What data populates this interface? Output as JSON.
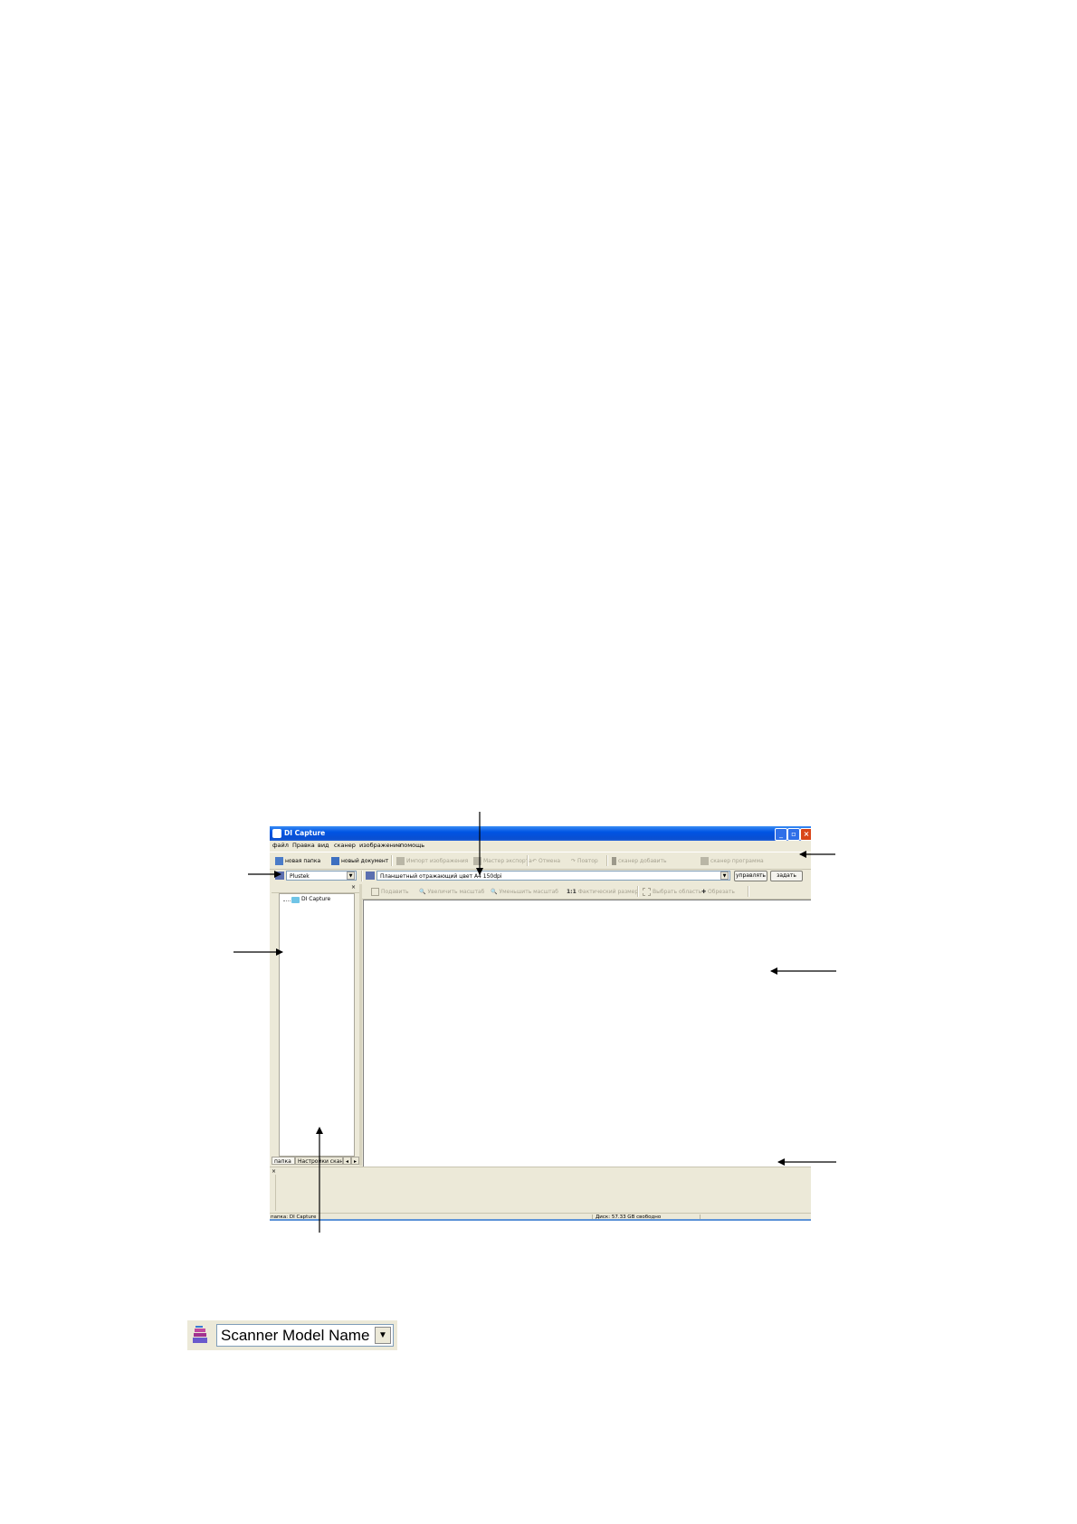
{
  "window": {
    "title": "DI Capture"
  },
  "menu": [
    "файл",
    "Правка",
    "вид",
    "сканер",
    "изображение",
    "помощь"
  ],
  "toolbar": {
    "new_folder": "новая папка",
    "new_document": "новый документ",
    "import_images": "Импорт изображения",
    "export_wizard": "Мастер экспорта",
    "undo": "Отмена",
    "redo": "Повтор",
    "scanner_add": "сканер добавить",
    "scanner_program": "сканер программа"
  },
  "scanner": {
    "model_value": "Plustek",
    "profile_value": "Планшетный отражающий цвет А4 150dpi",
    "manage_button": "управлять",
    "scan_button": "задать"
  },
  "image_toolbar": {
    "delete": "Подавить",
    "zoom_in": "Увеличить масштаб",
    "zoom_out": "Уменьшить масштаб",
    "actual_size_glyph": "1:1",
    "actual_size": "Фактический размер",
    "select_area": "Выбрать область",
    "crop": "Обрезать"
  },
  "tree": {
    "root": "DI Capture"
  },
  "left_tabs": {
    "folders": "папка",
    "scan_settings": "Настройки скан"
  },
  "status": {
    "folder": "папка: DI Capture",
    "disk": "Диск: 57.33 GB свободно"
  },
  "widget": {
    "value": "Scanner Model Name"
  }
}
